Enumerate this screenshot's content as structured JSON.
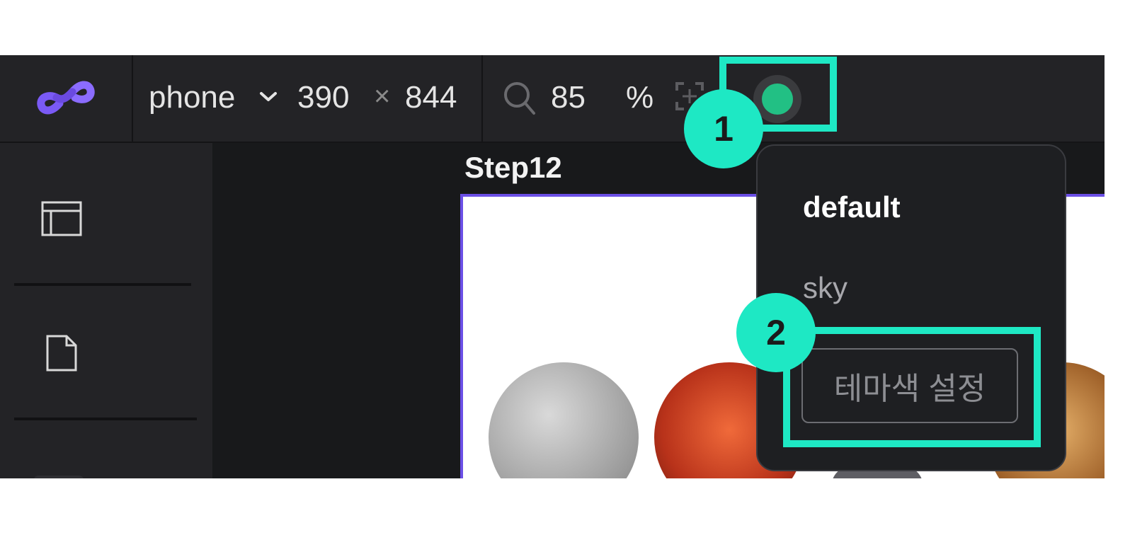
{
  "toolbar": {
    "device_type": "phone",
    "width": "390",
    "times": "×",
    "height": "844",
    "zoom_value": "85",
    "zoom_unit": "%",
    "theme_color": "#22c084"
  },
  "icons": {
    "logo": "link-logo-icon",
    "chevron": "chevron-down-icon",
    "search": "search-icon",
    "fit": "fit-screen-icon",
    "layout": "layout-icon",
    "page": "page-icon"
  },
  "canvas": {
    "step_title": "Step12"
  },
  "theme_menu": {
    "options": [
      "default",
      "sky"
    ],
    "setting_button": "테마색 설정"
  },
  "annotations": {
    "marker_1": "1",
    "marker_2": "2",
    "highlight_color": "#1ee8c4"
  }
}
